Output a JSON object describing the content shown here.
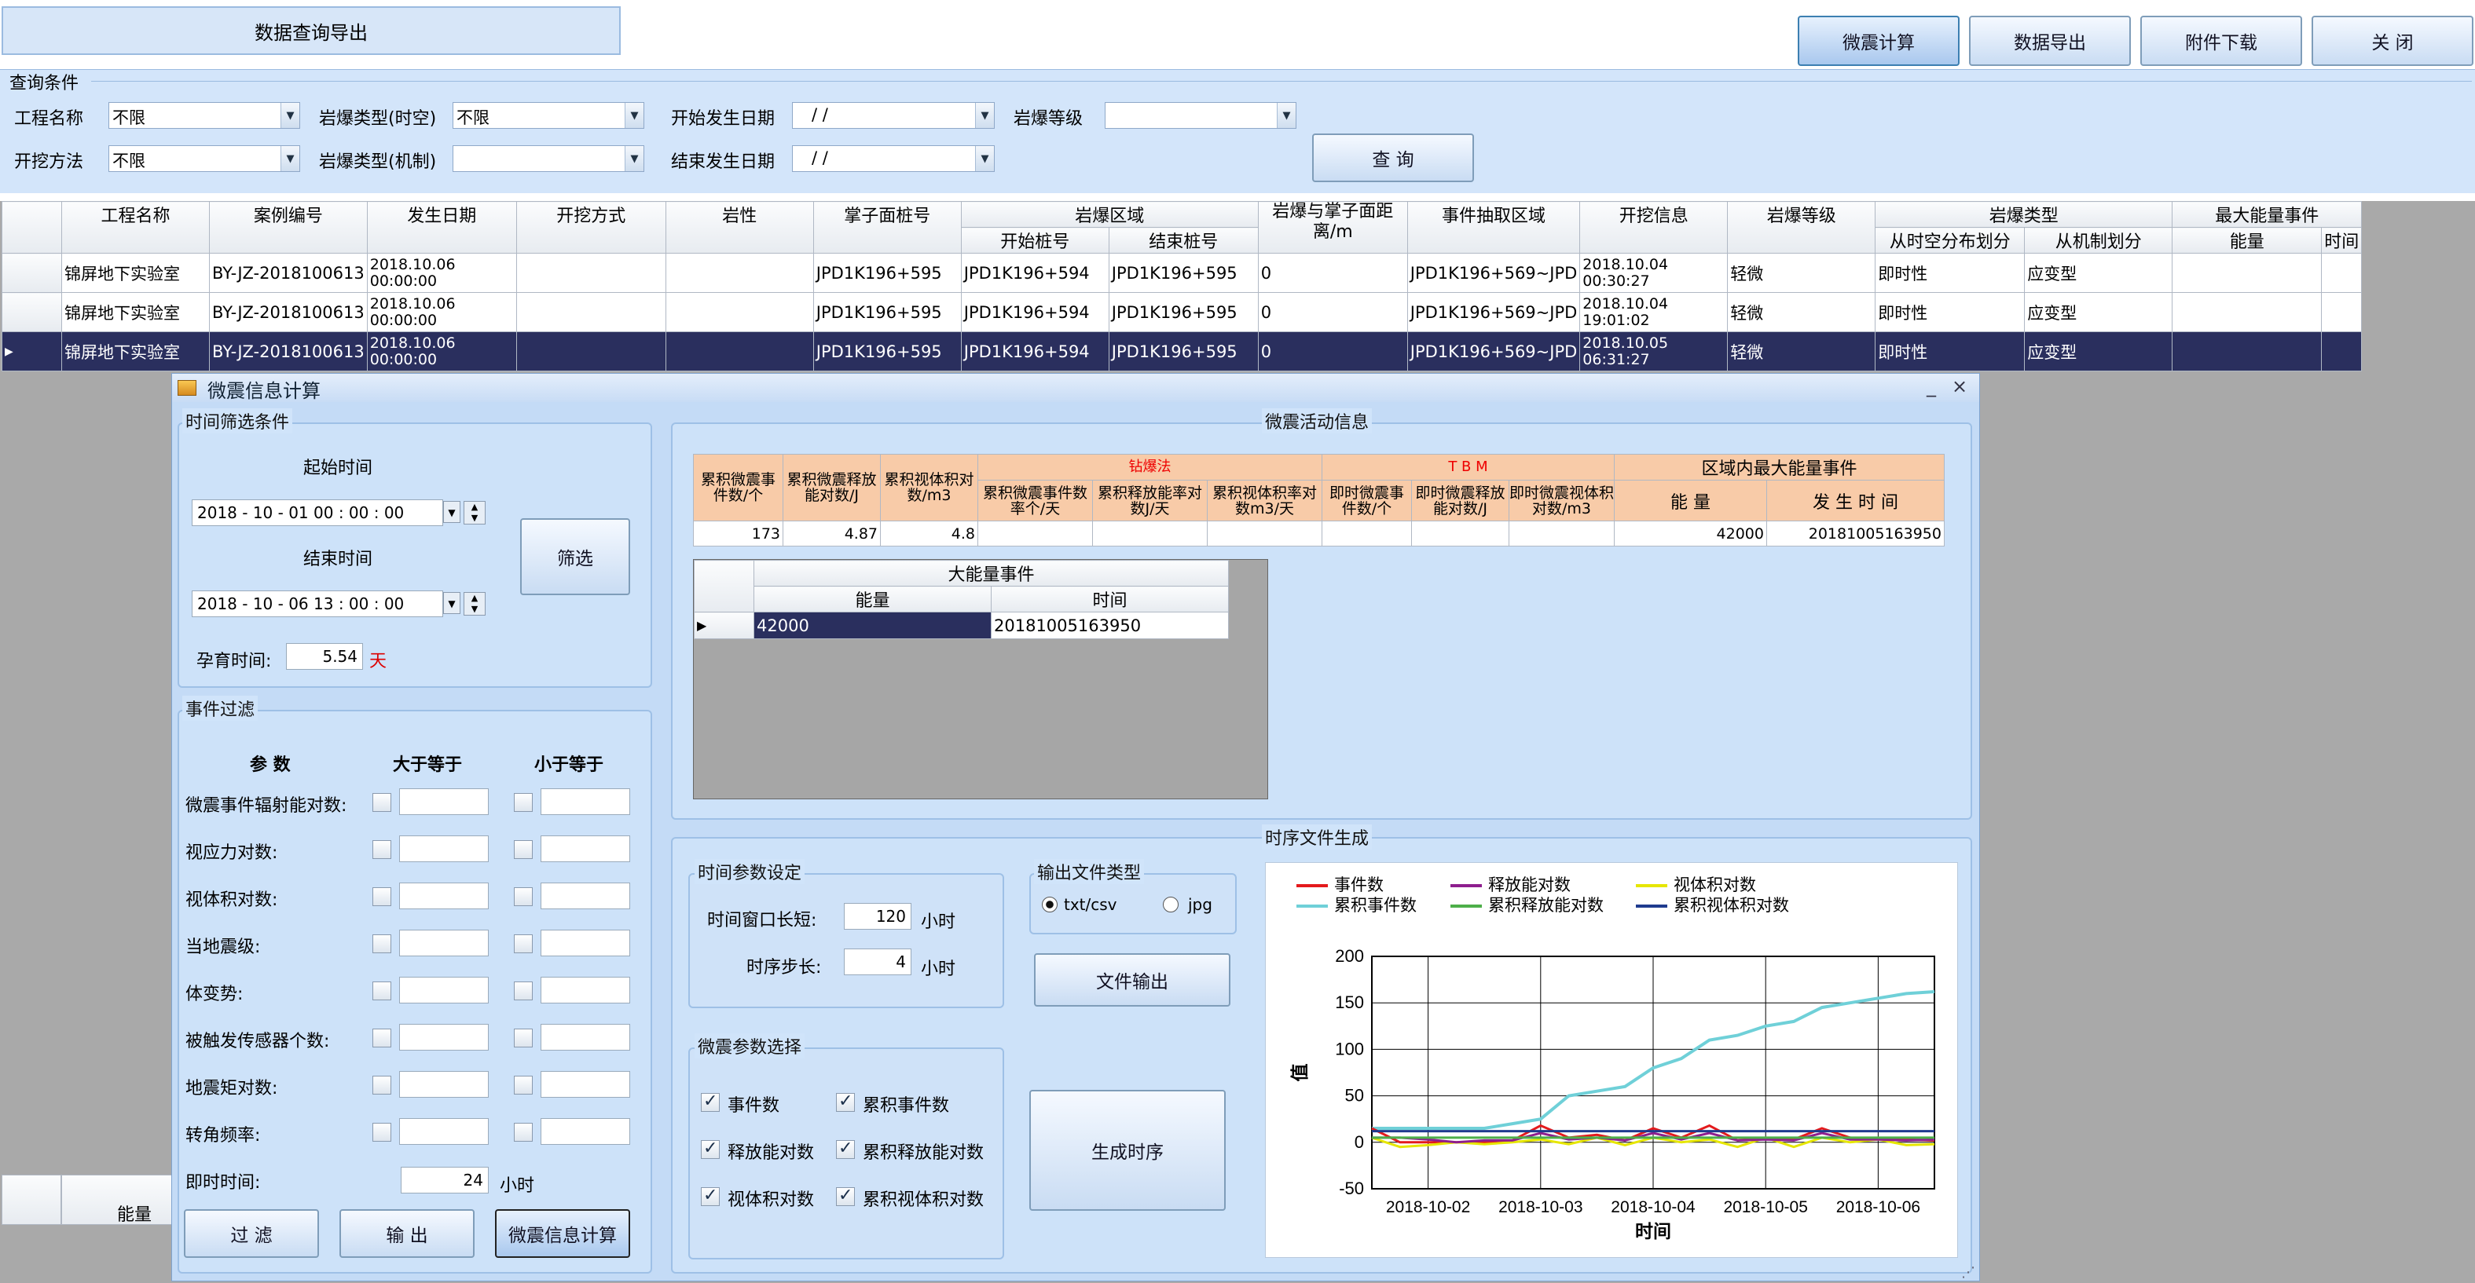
{
  "top": {
    "title_label": "数据查询导出",
    "buttons": [
      "微震计算",
      "数据导出",
      "附件下载",
      "关  闭"
    ]
  },
  "query": {
    "group_label": "查询条件",
    "project_label": "工程名称",
    "project_value": "不限",
    "type_space_label": "岩爆类型(时空)",
    "type_space_value": "不限",
    "start_date_label": "开始发生日期",
    "start_date_value": "/  /",
    "grade_label": "岩爆等级",
    "grade_value": "",
    "method_label": "开挖方法",
    "method_value": "不限",
    "type_mech_label": "岩爆类型(机制)",
    "type_mech_value": "",
    "end_date_label": "结束发生日期",
    "end_date_value": "/  /",
    "search_button": "查  询"
  },
  "main_table": {
    "headers": [
      "工程名称",
      "案例编号",
      "发生日期",
      "开挖方式",
      "岩性",
      "掌子面桩号",
      "岩爆区域",
      "岩爆与掌子面距离/m",
      "事件抽取区域",
      "开挖信息",
      "岩爆等级",
      "岩爆类型",
      "最大能量事件"
    ],
    "sub_headers": {
      "zone": [
        "开始桩号",
        "结束桩号"
      ],
      "type": [
        "从时空分布划分",
        "从机制划分"
      ],
      "max": [
        "能量",
        "时间"
      ]
    },
    "rows": [
      {
        "project": "锦屏地下实验室",
        "case": "BY-JZ-2018100613",
        "date1": "2018.10.06",
        "date2": "00:00:00",
        "method": "",
        "rock": "",
        "face": "JPD1K196+595",
        "zone_start": "JPD1K196+594",
        "zone_end": "JPD1K196+595",
        "dist": "0",
        "extract": "JPD1K196+569~JPD",
        "info1": "2018.10.04",
        "info2": "00:30:27",
        "grade": "轻微",
        "type_space": "即时性",
        "type_mech": "应变型",
        "energy": "",
        "time": ""
      },
      {
        "project": "锦屏地下实验室",
        "case": "BY-JZ-2018100613",
        "date1": "2018.10.06",
        "date2": "00:00:00",
        "method": "",
        "rock": "",
        "face": "JPD1K196+595",
        "zone_start": "JPD1K196+594",
        "zone_end": "JPD1K196+595",
        "dist": "0",
        "extract": "JPD1K196+569~JPD",
        "info1": "2018.10.04",
        "info2": "19:01:02",
        "grade": "轻微",
        "type_space": "即时性",
        "type_mech": "应变型",
        "energy": "",
        "time": ""
      },
      {
        "project": "锦屏地下实验室",
        "case": "BY-JZ-2018100613",
        "date1": "2018.10.06",
        "date2": "00:00:00",
        "method": "",
        "rock": "",
        "face": "JPD1K196+595",
        "zone_start": "JPD1K196+594",
        "zone_end": "JPD1K196+595",
        "dist": "0",
        "extract": "JPD1K196+569~JPD",
        "info1": "2018.10.05",
        "info2": "06:31:27",
        "grade": "轻微",
        "type_space": "即时性",
        "type_mech": "应变型",
        "energy": "",
        "time": ""
      }
    ],
    "bottom_header": "能量"
  },
  "dialog": {
    "title": "微震信息计算",
    "time_filter": {
      "group": "时间筛选条件",
      "start_label": "起始时间",
      "start_value": "2018 - 10 - 01   00 : 00 : 00",
      "end_label": "结束时间",
      "end_value": "2018 - 10 - 06   13 : 00 : 00",
      "filter_button": "筛选",
      "gestation_label": "孕育时间:",
      "gestation_value": "5.54",
      "gestation_unit": "天"
    },
    "event_filter": {
      "group": "事件过滤",
      "col_param": "参  数",
      "col_ge": "大于等于",
      "col_le": "小于等于",
      "params": [
        "微震事件辐射能对数:",
        "视应力对数:",
        "视体积对数:",
        "当地震级:",
        "体变势:",
        "被触发传感器个数:",
        "地震矩对数:",
        "转角频率:"
      ],
      "instant_label": "即时时间:",
      "instant_value": "24",
      "instant_unit": "小时"
    },
    "buttons": [
      "过  滤",
      "输  出",
      "微震信息计算"
    ],
    "activity": {
      "group": "微震活动信息",
      "drill_label": "钻爆法",
      "tbm_label": "T B M",
      "max_label": "区域内最大能量事件",
      "headers": [
        "累积微震事件数/个",
        "累积微震释放能对数/J",
        "累积视体积对数/m3",
        "累积微震事件数率个/天",
        "累积释放能率对数J/天",
        "累积视体积率对数m3/天",
        "即时微震事件数/个",
        "即时微震释放能对数/J",
        "即时微震视体积对数/m3",
        "能  量",
        "发 生 时 间"
      ],
      "values": [
        "173",
        "4.87",
        "4.8",
        "",
        "",
        "",
        "",
        "",
        "",
        "42000",
        "20181005163950"
      ],
      "big_title": "大能量事件",
      "big_headers": [
        "能量",
        "时间"
      ],
      "big_row": [
        "42000",
        "20181005163950"
      ]
    },
    "sequence": {
      "group": "时序文件生成",
      "time_param_group": "时间参数设定",
      "window_label": "时间窗口长短:",
      "window_value": "120",
      "window_unit": "小时",
      "step_label": "时序步长:",
      "step_value": "4",
      "step_unit": "小时",
      "out_type_group": "输出文件类型",
      "radio_txt": "txt/csv",
      "radio_jpg": "jpg",
      "file_out_button": "文件输出",
      "param_group": "微震参数选择",
      "checks": [
        "事件数",
        "累积事件数",
        "释放能对数",
        "累积释放能对数",
        "视体积对数",
        "累积视体积对数"
      ],
      "gen_button": "生成时序"
    }
  },
  "chart_data": {
    "type": "line",
    "xlabel": "时间",
    "ylabel": "值",
    "ylim": [
      -50,
      200
    ],
    "yticks": [
      "200",
      "150",
      "100",
      "50",
      "0",
      "-50"
    ],
    "xticks": [
      "2018-10-02",
      "2018-10-03",
      "2018-10-04",
      "2018-10-05",
      "2018-10-06"
    ],
    "legend": [
      "事件数",
      "释放能对数",
      "视体积对数",
      "累积事件数",
      "累积释放能对数",
      "累积视体积对数"
    ],
    "colors": {
      "事件数": "#e41a1c",
      "释放能对数": "#8e1e8e",
      "视体积对数": "#e6e600",
      "累积事件数": "#6fd0d8",
      "累积释放能对数": "#4daf4a",
      "累积视体积对数": "#1f3b8f"
    },
    "x": [
      1.5,
      1.75,
      2.0,
      2.25,
      2.5,
      2.75,
      3.0,
      3.25,
      3.5,
      3.75,
      4.0,
      4.25,
      4.5,
      4.75,
      5.0,
      5.25,
      5.5,
      5.75,
      6.0,
      6.25,
      6.5
    ],
    "series": [
      {
        "name": "累积事件数",
        "values": [
          15,
          15,
          15,
          15,
          15,
          20,
          25,
          50,
          55,
          60,
          80,
          90,
          110,
          115,
          125,
          130,
          145,
          150,
          155,
          160,
          162
        ]
      },
      {
        "name": "事件数",
        "values": [
          15,
          0,
          0,
          0,
          0,
          2,
          18,
          5,
          8,
          2,
          15,
          5,
          18,
          2,
          5,
          3,
          15,
          5,
          3,
          3,
          2
        ]
      },
      {
        "name": "视体积对数",
        "values": [
          5,
          -5,
          -3,
          0,
          -2,
          0,
          3,
          -2,
          5,
          -3,
          5,
          0,
          3,
          -5,
          5,
          -5,
          5,
          0,
          3,
          -3,
          -2
        ]
      },
      {
        "name": "释放能对数",
        "values": [
          5,
          5,
          3,
          0,
          2,
          2,
          10,
          3,
          5,
          2,
          10,
          3,
          10,
          2,
          3,
          2,
          10,
          3,
          3,
          2,
          3
        ]
      },
      {
        "name": "累积释放能对数",
        "values": [
          5,
          5,
          5,
          5,
          5,
          5,
          5,
          5,
          5,
          5,
          5,
          5,
          5,
          5,
          5,
          5,
          5,
          5,
          5,
          5,
          5
        ]
      },
      {
        "name": "累积视体积对数",
        "values": [
          12,
          12,
          12,
          12,
          12,
          12,
          12,
          12,
          12,
          12,
          12,
          12,
          12,
          12,
          12,
          12,
          12,
          12,
          12,
          12,
          12
        ]
      }
    ]
  }
}
